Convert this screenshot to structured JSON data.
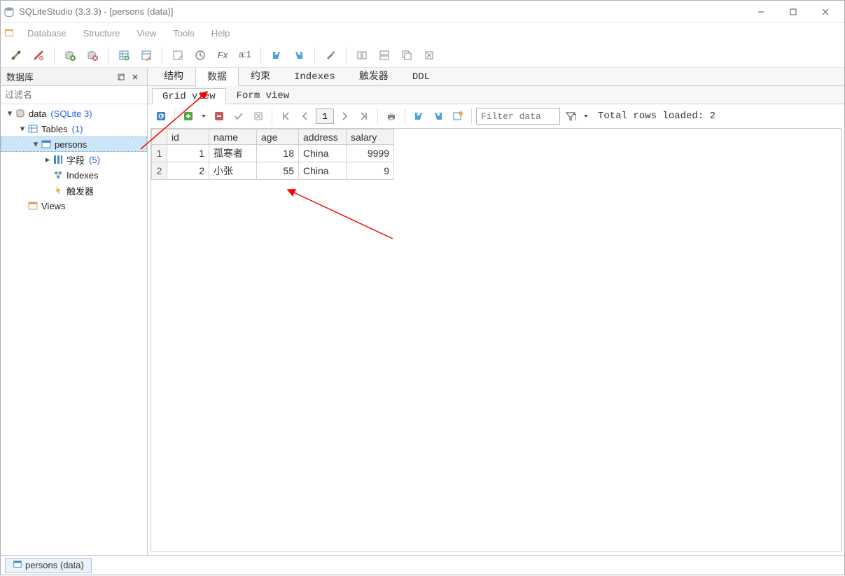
{
  "app_title": "SQLiteStudio (3.3.3) - [persons (data)]",
  "menu": {
    "database": "Database",
    "structure": "Structure",
    "view": "View",
    "tools": "Tools",
    "help": "Help"
  },
  "leftpanel": {
    "header": "数据库",
    "filter_placeholder": "过滤名",
    "db": {
      "name": "data",
      "engine": "(SQLite 3)"
    },
    "tables_label": "Tables",
    "tables_count": "(1)",
    "table_name": "persons",
    "fields_label": "字段",
    "fields_count": "(5)",
    "indexes_label": "Indexes",
    "triggers_label": "触发器",
    "views_label": "Views"
  },
  "tabs": {
    "structure": "结构",
    "data": "数据",
    "constraints": "约束",
    "indexes": "Indexes",
    "triggers": "触发器",
    "ddl": "DDL"
  },
  "subtabs": {
    "grid": "Grid view",
    "form": "Form view"
  },
  "datatoolbar": {
    "page": "1",
    "filter_placeholder": "Filter data",
    "status": "Total rows loaded: 2"
  },
  "grid": {
    "columns": [
      "id",
      "name",
      "age",
      "address",
      "salary"
    ],
    "rows": [
      {
        "num": "1",
        "cells": [
          "1",
          "孤寒者",
          "18",
          "China",
          "9999"
        ]
      },
      {
        "num": "2",
        "cells": [
          "2",
          "小张",
          "55",
          "China",
          "9"
        ]
      }
    ]
  },
  "statusbar": {
    "tab": "persons (data)"
  }
}
